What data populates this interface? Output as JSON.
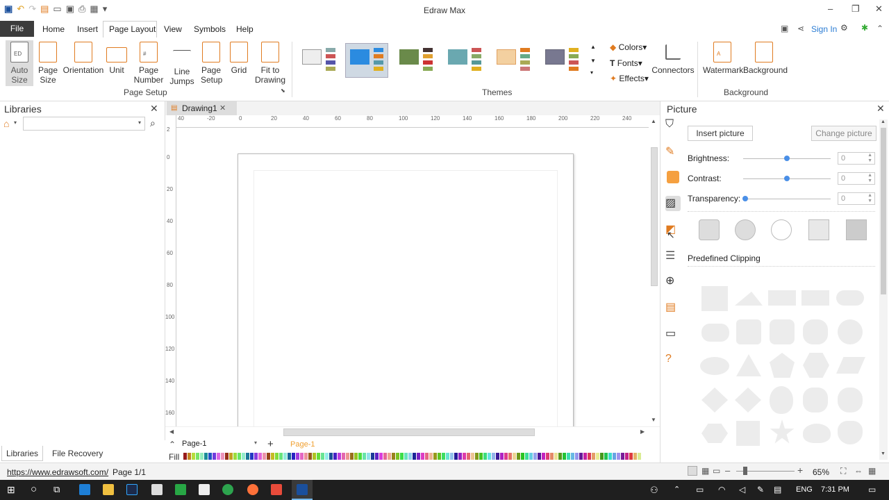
{
  "app": {
    "title": "Edraw Max"
  },
  "menu": {
    "file": "File",
    "home": "Home",
    "insert": "Insert",
    "page_layout": "Page Layout",
    "view": "View",
    "symbols": "Symbols",
    "help": "Help",
    "sign_in": "Sign In"
  },
  "ribbon": {
    "auto_size": "Auto Size",
    "page_size": "Page Size",
    "orientation": "Orientation",
    "unit": "Unit",
    "page_number": "Page Number",
    "line_jumps": "Line Jumps",
    "page_setup_btn": "Page Setup",
    "grid": "Grid",
    "fit_to_drawing": "Fit to Drawing",
    "group_page_setup": "Page Setup",
    "group_themes": "Themes",
    "group_background": "Background",
    "colors": "Colors",
    "fonts": "Fonts",
    "effects": "Effects",
    "connectors": "Connectors",
    "watermark": "Watermark",
    "background": "Background"
  },
  "libraries": {
    "title": "Libraries",
    "tab_libraries": "Libraries",
    "tab_file_recovery": "File Recovery"
  },
  "document": {
    "tab": "Drawing1",
    "page_selector": "Page-1",
    "page_tab": "Page-1",
    "fill_label": "Fill"
  },
  "ruler": {
    "h": [
      "40",
      "-20",
      "0",
      "20",
      "40",
      "60",
      "80",
      "100",
      "120",
      "140",
      "160",
      "180",
      "200",
      "220",
      "240"
    ],
    "v": [
      "2",
      "0",
      "20",
      "40",
      "60",
      "80",
      "100",
      "120",
      "140",
      "160"
    ]
  },
  "picture": {
    "title": "Picture",
    "insert": "Insert picture",
    "change": "Change picture",
    "brightness": "Brightness:",
    "contrast": "Contrast:",
    "transparency": "Transparency:",
    "brightness_val": "0",
    "contrast_val": "0",
    "transparency_val": "0",
    "predefined": "Predefined Clipping"
  },
  "status": {
    "url": "https://www.edrawsoft.com/",
    "page": "Page 1/1",
    "zoom": "65%"
  },
  "taskbar": {
    "lang": "ENG",
    "time": "7:31 PM"
  },
  "colors": {
    "accent": "#2b7cd3",
    "file_tab": "#3c3c3c",
    "page_tab": "#f0a030"
  }
}
